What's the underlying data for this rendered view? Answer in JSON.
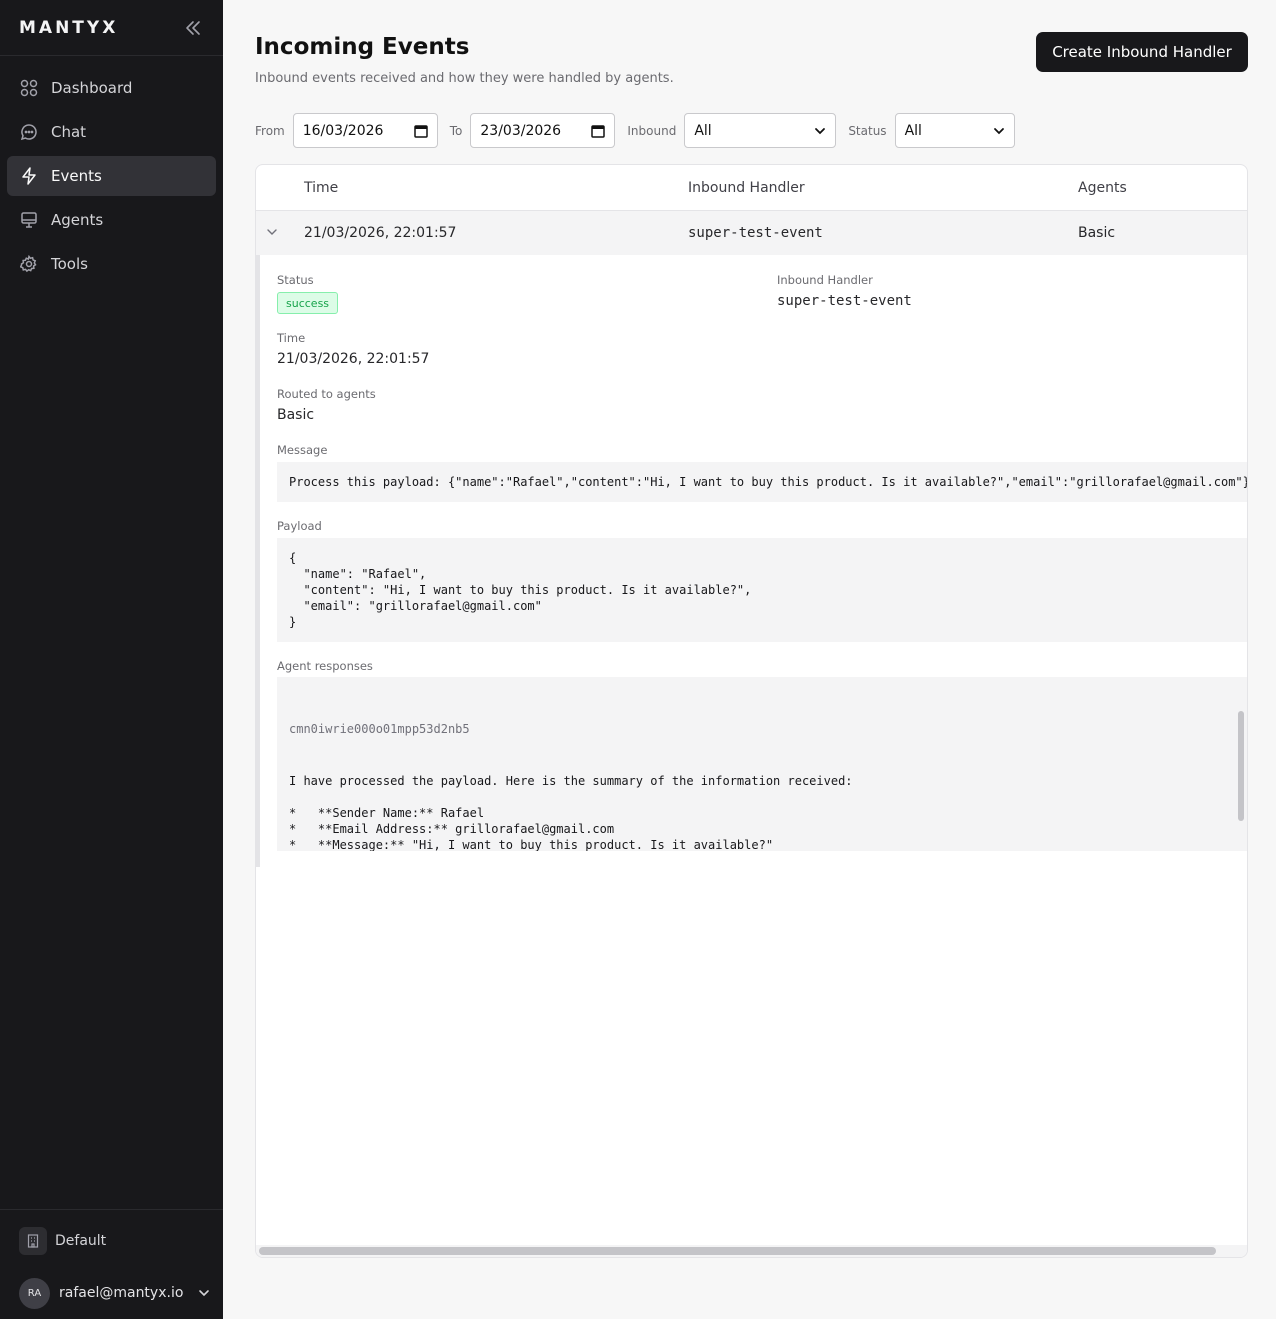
{
  "sidebar": {
    "brand": "MANTYX",
    "items": [
      {
        "label": "Dashboard",
        "icon": "grid-icon"
      },
      {
        "label": "Chat",
        "icon": "chat-icon"
      },
      {
        "label": "Events",
        "icon": "bolt-icon"
      },
      {
        "label": "Agents",
        "icon": "monitor-icon"
      },
      {
        "label": "Tools",
        "icon": "gear-icon"
      }
    ],
    "active": "Events",
    "workspace": "Default",
    "user": {
      "initials": "RA",
      "email": "rafael@mantyx.io"
    }
  },
  "header": {
    "title": "Incoming Events",
    "subtitle": "Inbound events received and how they were handled by agents.",
    "create_button": "Create Inbound Handler"
  },
  "filters": {
    "from_label": "From",
    "from_value": "16/03/2026",
    "to_label": "To",
    "to_value": "23/03/2026",
    "inbound_label": "Inbound",
    "inbound_value": "All",
    "status_label": "Status",
    "status_value": "All"
  },
  "table": {
    "columns": [
      "Time",
      "Inbound Handler",
      "Agents"
    ],
    "rows": [
      {
        "time": "21/03/2026, 22:01:57",
        "handler": "super-test-event",
        "agents": "Basic",
        "expanded": true
      }
    ]
  },
  "detail": {
    "status_label": "Status",
    "status_value": "success",
    "handler_label": "Inbound Handler",
    "handler_value": "super-test-event",
    "time_label": "Time",
    "time_value": "21/03/2026, 22:01:57",
    "routed_label": "Routed to agents",
    "routed_value": "Basic",
    "message_label": "Message",
    "message_value": "Process this payload: {\"name\":\"Rafael\",\"content\":\"Hi, I want to buy this product. Is it available?\",\"email\":\"grillorafael@gmail.com\"}",
    "payload_label": "Payload",
    "payload_value": "{\n  \"name\": \"Rafael\",\n  \"content\": \"Hi, I want to buy this product. Is it available?\",\n  \"email\": \"grillorafael@gmail.com\"\n}",
    "responses_label": "Agent responses",
    "response_id": "cmn0iwrie000o01mpp53d2nb5",
    "response_text": "I have processed the payload. Here is the summary of the information received:\n\n*   **Sender Name:** Rafael\n*   **Email Address:** grillorafael@gmail.com\n*   **Message:** \"Hi, I want to buy this product. Is it available?\"\n\n**Response for Rafael:**\n\"Hi Rafael, thank you for your interest! To give you accurate information regarding availability, could you please specify which"
  }
}
